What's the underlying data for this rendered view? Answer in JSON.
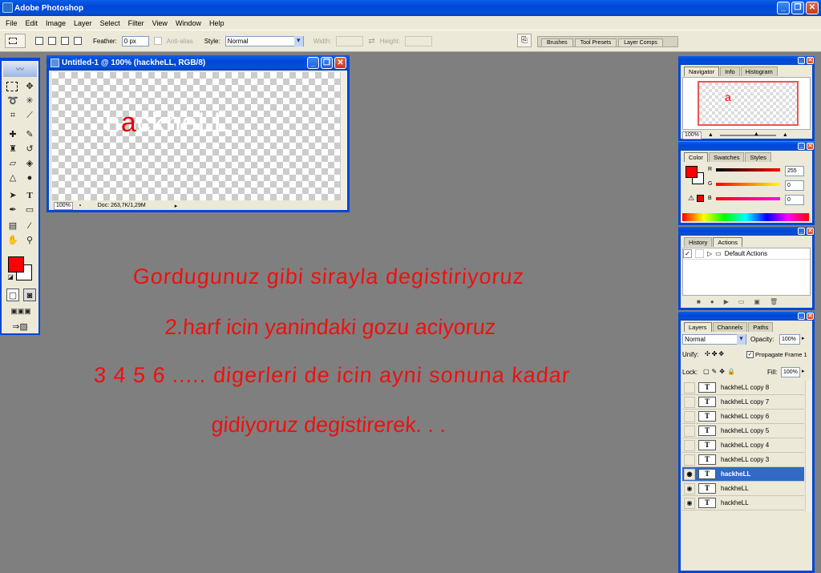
{
  "app": {
    "title": "Adobe Photoshop"
  },
  "menu": [
    "File",
    "Edit",
    "Image",
    "Layer",
    "Select",
    "Filter",
    "View",
    "Window",
    "Help"
  ],
  "options": {
    "feather_label": "Feather:",
    "feather_value": "0 px",
    "antialias_label": "Anti-alias",
    "style_label": "Style:",
    "style_value": "Normal",
    "width_label": "Width:",
    "height_label": "Height:"
  },
  "palette_well": [
    "Brushes",
    "Tool Presets",
    "Layer Comps"
  ],
  "document": {
    "title": "Untitled-1 @ 100% (hackheLL, RGB/8)",
    "zoom": "100%",
    "doc_info": "Doc: 263,7K/1,29M",
    "art_text_white_1": "h",
    "art_text_red": "a",
    "art_text_white_2": "ckheLL"
  },
  "colors": {
    "foreground": "#ff0000",
    "background": "#ffffff",
    "accent": "#0046d6",
    "handwriting": "#ee1010"
  },
  "handwritten": [
    "Gordugunuz gibi sirayla degistiriyoruz",
    "2.harf icin yanindaki gozu aciyoruz",
    "3 4 5 6 ..... digerleri de icin ayni sonuna kadar",
    "gidiyoruz degistirerek. . ."
  ],
  "navigator": {
    "tabs": [
      "Navigator",
      "Info",
      "Histogram"
    ],
    "zoom": "100%",
    "preview_text": "a"
  },
  "color_panel": {
    "tabs": [
      "Color",
      "Swatches",
      "Styles"
    ],
    "r_label": "R",
    "g_label": "G",
    "b_label": "B",
    "r": "255",
    "g": "0",
    "b": "0"
  },
  "actions_panel": {
    "tabs": [
      "History",
      "Actions"
    ],
    "item": "Default Actions"
  },
  "layers_panel": {
    "tabs": [
      "Layers",
      "Channels",
      "Paths"
    ],
    "blend_mode": "Normal",
    "opacity_label": "Opacity:",
    "opacity": "100%",
    "unify_label": "Unify:",
    "propagate_label": "Propagate Frame 1",
    "lock_label": "Lock:",
    "fill_label": "Fill:",
    "fill": "100%",
    "layers": [
      {
        "name": "hackheLL copy 8",
        "visible": false,
        "selected": false
      },
      {
        "name": "hackheLL copy 7",
        "visible": false,
        "selected": false
      },
      {
        "name": "hackheLL copy 6",
        "visible": false,
        "selected": false
      },
      {
        "name": "hackheLL copy 5",
        "visible": false,
        "selected": false
      },
      {
        "name": "hackheLL copy 4",
        "visible": false,
        "selected": false
      },
      {
        "name": "hackheLL copy 3",
        "visible": false,
        "selected": false
      },
      {
        "name": "hackheLL",
        "visible": true,
        "selected": true
      },
      {
        "name": "hackheLL",
        "visible": true,
        "selected": false
      },
      {
        "name": "hackheLL",
        "visible": true,
        "selected": false
      }
    ]
  }
}
